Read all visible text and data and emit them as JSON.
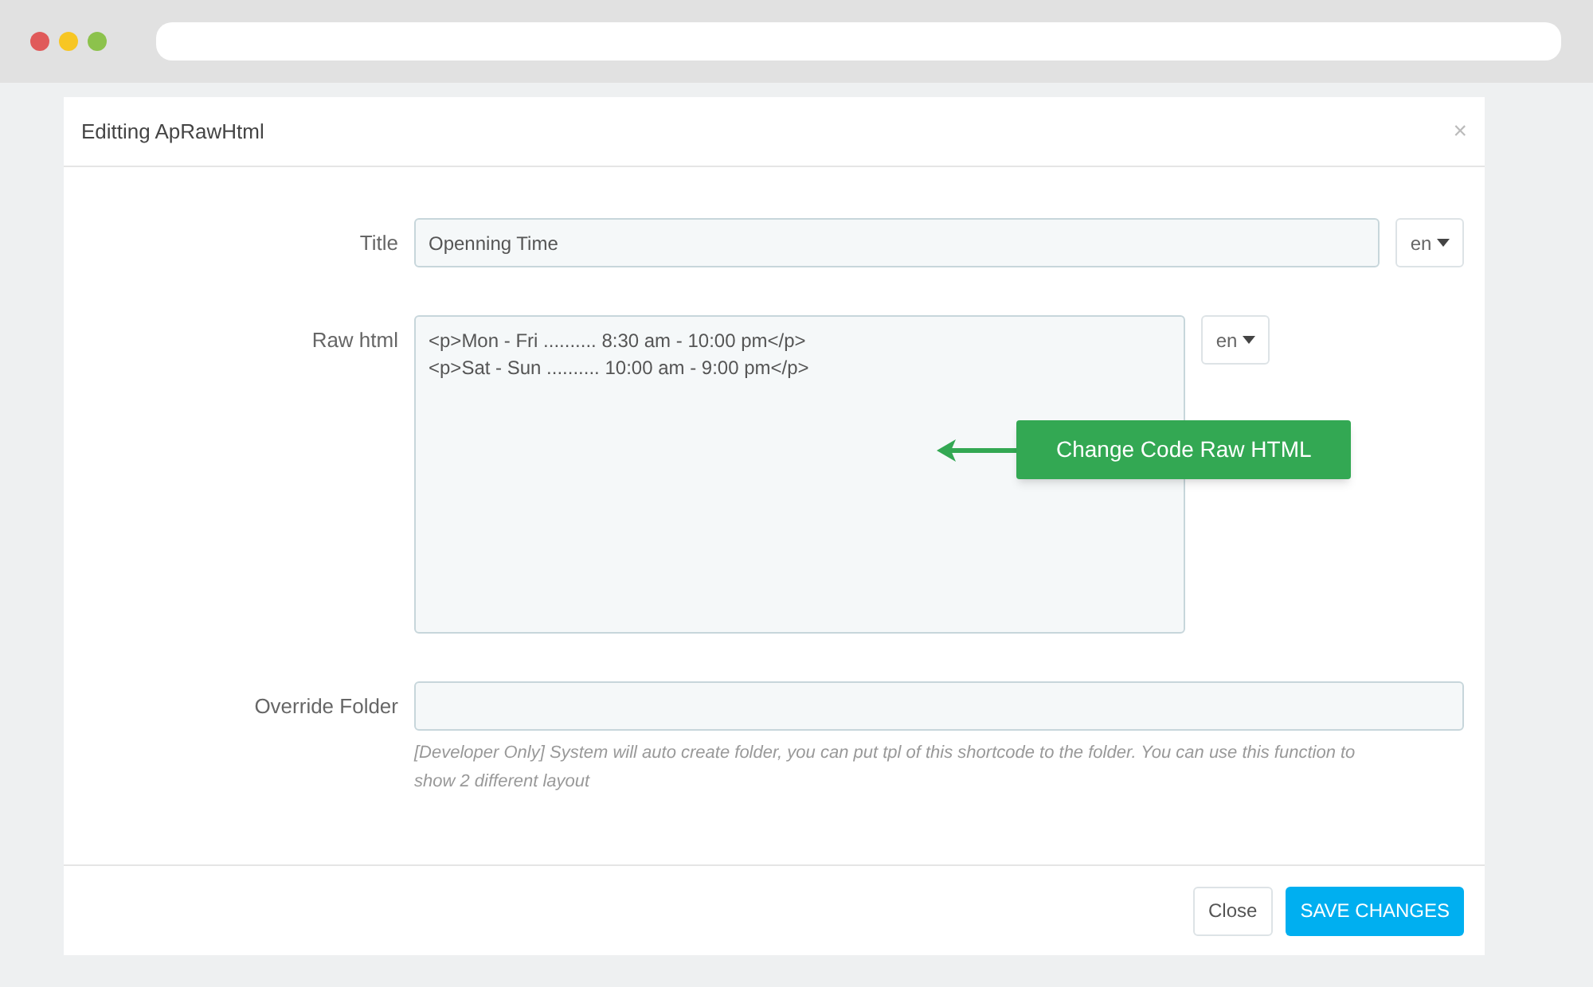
{
  "dialog": {
    "title": "Editting ApRawHtml",
    "close": "×"
  },
  "fields": [
    {
      "kind": "input",
      "label": "Title",
      "value": "Openning Time",
      "language": "en"
    },
    {
      "kind": "code",
      "label": "Raw html",
      "lines": [
        "<p>Mon - Fri .......... 8:30 am - 10:00 pm</p>",
        "<p>Sat - Sun .......... 10:00 am - 9:00 pm</p>"
      ],
      "language": "en",
      "callout": "Change Code Raw HTML"
    },
    {
      "kind": "input",
      "label": "Override Folder",
      "help": "[Developer Only] System will auto create folder, you can put tpl of this shortcode to the folder. You can use this function to show 2 different layout"
    }
  ],
  "buttons": [
    {
      "label": "Close",
      "primary": false
    },
    {
      "label": "SAVE CHANGES",
      "primary": true
    }
  ]
}
